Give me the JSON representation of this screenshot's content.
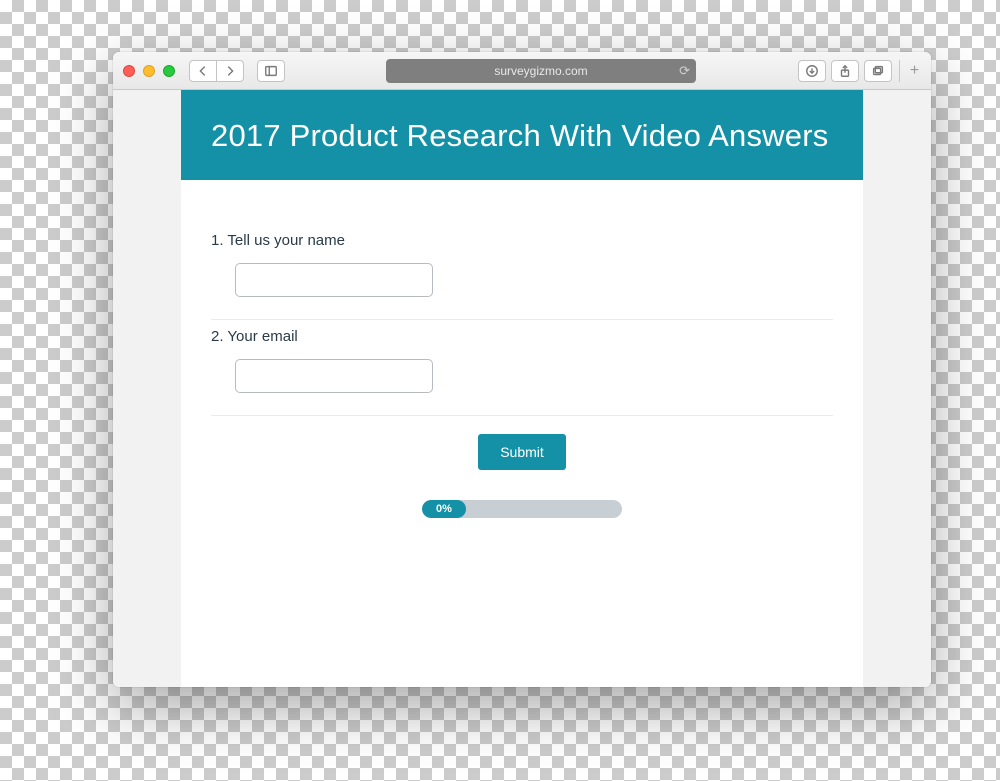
{
  "browser": {
    "address": "surveygizmo.com"
  },
  "survey": {
    "title": "2017 Product Research With Video Answers",
    "questions": [
      {
        "num": "1.",
        "label": "Tell us your name",
        "value": ""
      },
      {
        "num": "2.",
        "label": "Your email",
        "value": ""
      }
    ],
    "submit_label": "Submit",
    "progress_label": "0%"
  }
}
